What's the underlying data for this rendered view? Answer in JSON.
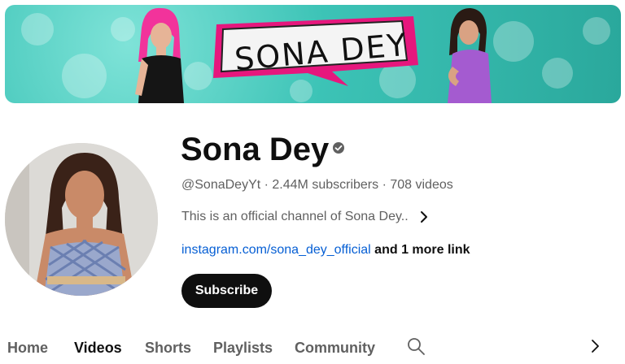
{
  "banner": {
    "logo_text": "SONA DEY",
    "background_color": "#3cc3b6",
    "accent_color": "#e6177d"
  },
  "channel": {
    "name": "Sona Dey",
    "verified": true,
    "handle": "@SonaDeyYt",
    "separator": " · ",
    "subscribers": "2.44M subscribers",
    "videos": "708 videos",
    "description": "This is an official channel of Sona Dey..",
    "link_text": "instagram.com/sona_dey_official",
    "more_links": "and 1 more link",
    "subscribe_label": "Subscribe"
  },
  "tabs": [
    {
      "label": "Home",
      "active": false
    },
    {
      "label": "Videos",
      "active": true
    },
    {
      "label": "Shorts",
      "active": false
    },
    {
      "label": "Playlists",
      "active": false
    },
    {
      "label": "Community",
      "active": false
    }
  ],
  "icons": {
    "verified": "verified-check-icon",
    "description_more": "chevron-right-icon",
    "search": "search-icon",
    "tabs_next": "chevron-right-icon"
  }
}
